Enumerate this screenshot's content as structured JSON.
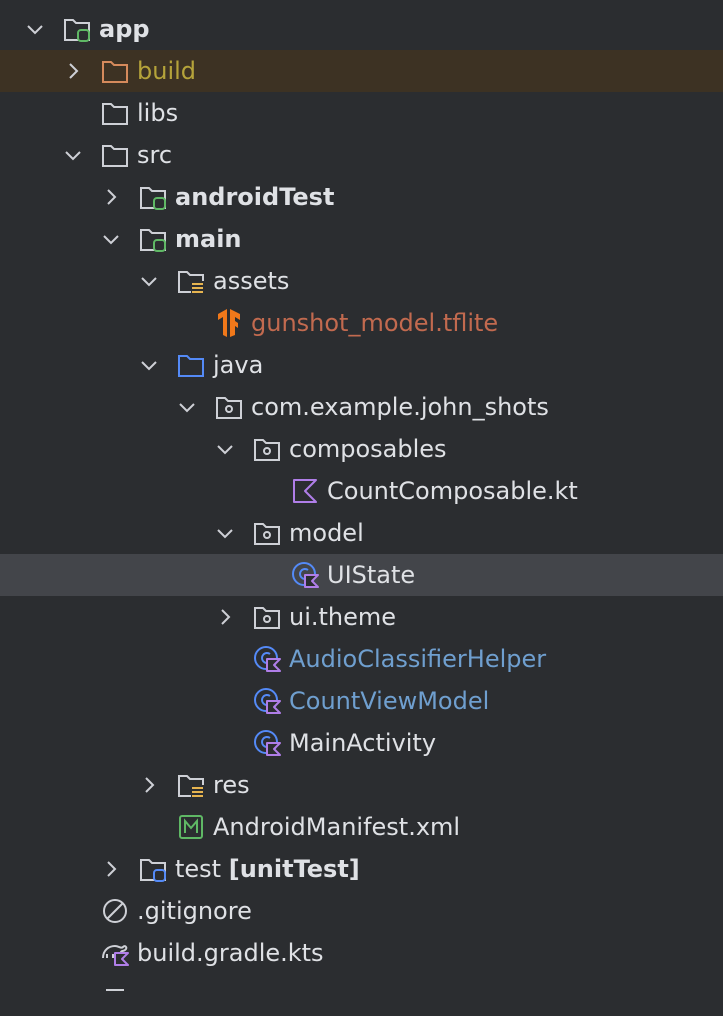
{
  "tree": {
    "app": "app",
    "build": "build",
    "libs": "libs",
    "src": "src",
    "androidTest": "androidTest",
    "main": "main",
    "assets": "assets",
    "tflite": "gunshot_model.tflite",
    "java": "java",
    "package": "com.example.john_shots",
    "composables": "composables",
    "countComposable": "CountComposable.kt",
    "model": "model",
    "uiState": "UIState",
    "uiTheme": "ui.theme",
    "audioHelper": "AudioClassifierHelper",
    "countViewModel": "CountViewModel",
    "mainActivity": "MainActivity",
    "res": "res",
    "manifest": "AndroidManifest.xml",
    "test": "test",
    "unitTest": "[unitTest]",
    "gitignore": ".gitignore",
    "buildGradle": "build.gradle.kts"
  },
  "colors": {
    "background": "#2b2d30",
    "selectedOrange": "#3d3223",
    "selectedGrey": "#43454a",
    "folder": "#ced0d6",
    "moduleGreen": "#5fb865",
    "javaBlue": "#548af7",
    "kotlinPurple": "#b07ee8",
    "tensorflowOrange": "#f0781a"
  }
}
